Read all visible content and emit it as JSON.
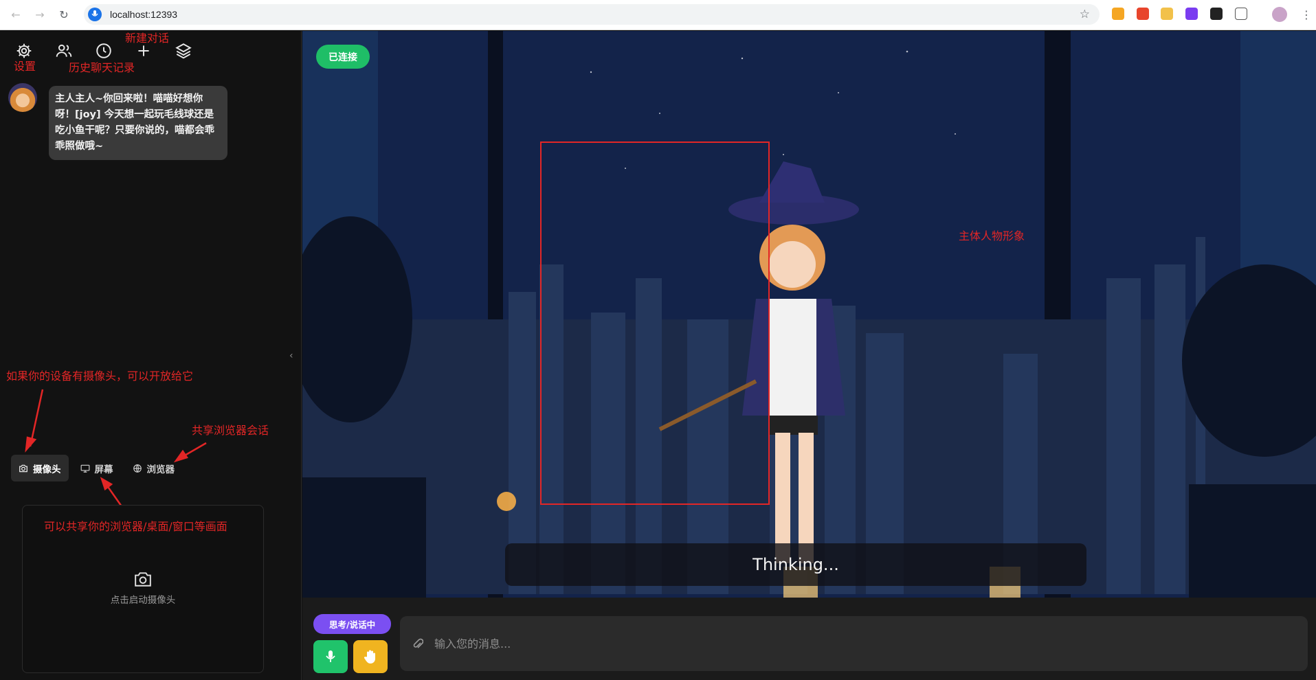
{
  "browser": {
    "url": "localhost:12393"
  },
  "sidebar": {
    "annotations": {
      "settings": "设置",
      "new_chat": "新建对话",
      "history": "历史聊天记录",
      "camera_hint": "如果你的设备有摄像头，可以开放给它",
      "share_browser": "共享浏览器会话",
      "share_screen": "可以共享你的浏览器/桌面/窗口等画面"
    },
    "message": "主人主人~你回来啦！喵喵好想你呀！[joy] 今天想一起玩毛线球还是吃小鱼干呢？只要你说的，喵都会乖乖照做哦~",
    "tabs": [
      {
        "label": "摄像头",
        "icon": "camera-icon"
      },
      {
        "label": "屏幕",
        "icon": "monitor-icon"
      },
      {
        "label": "浏览器",
        "icon": "globe-icon"
      }
    ],
    "camera_panel": {
      "hint": "点击启动摄像头"
    }
  },
  "stage": {
    "connection_status": "已连接",
    "character_annotation": "主体人物形象",
    "thinking_text": "Thinking..."
  },
  "bottombar": {
    "status": "思考/说话中",
    "input_placeholder": "输入您的消息..."
  },
  "colors": {
    "connected": "#1fbe67",
    "status": "#7b4ff2",
    "mic": "#20c36b",
    "hand": "#f0b420",
    "annotation": "#e32626"
  }
}
